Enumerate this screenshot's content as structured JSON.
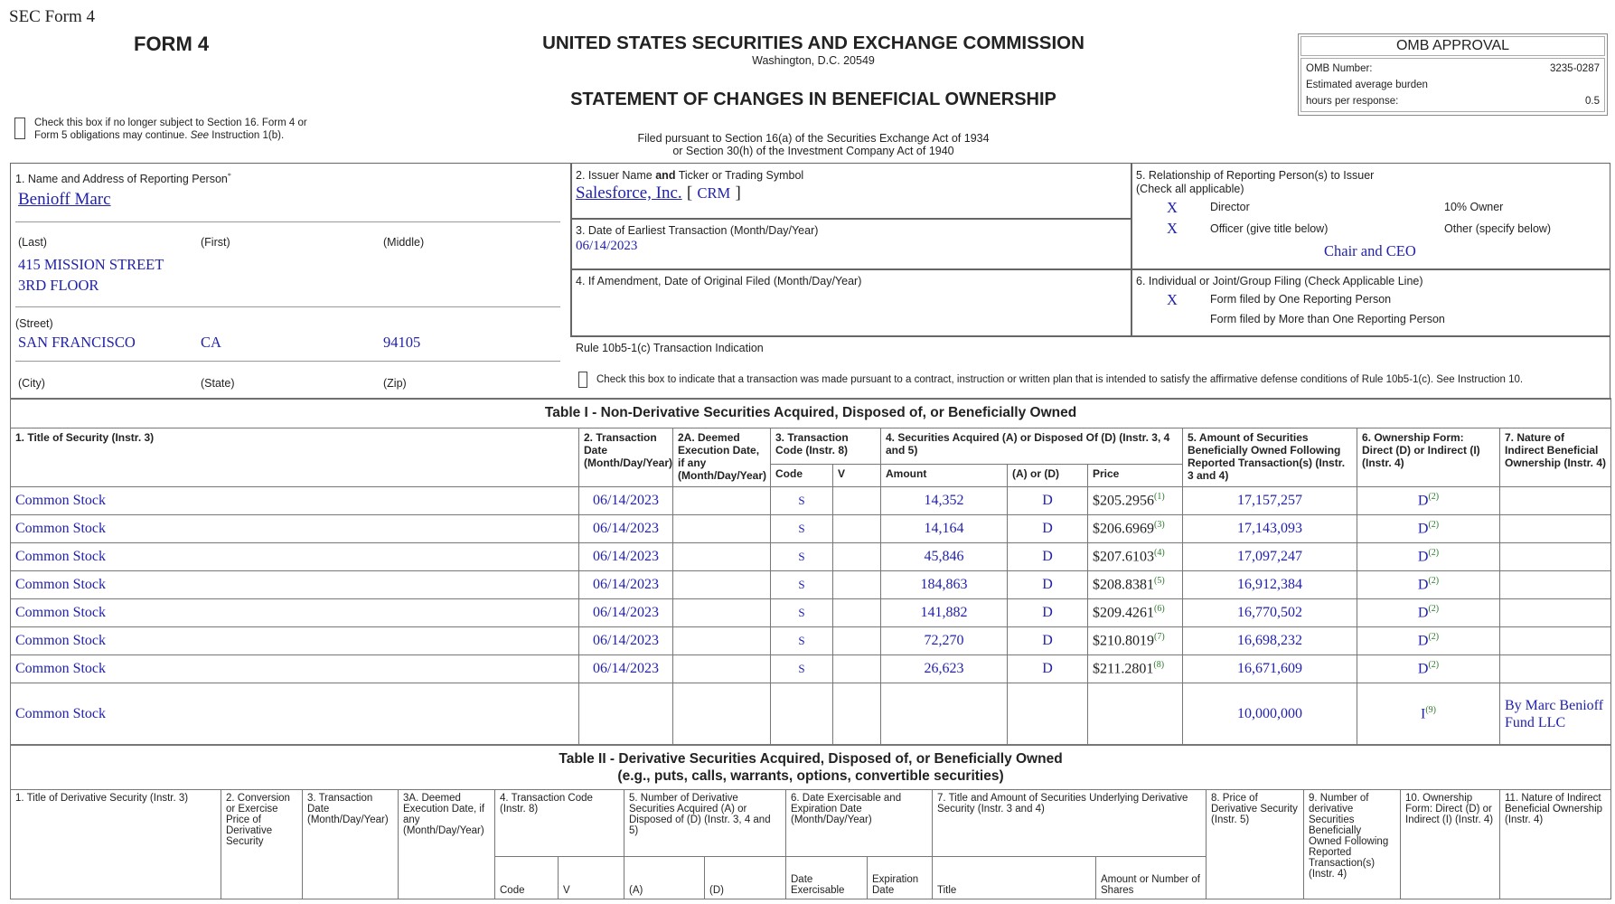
{
  "header": {
    "sec_form": "SEC Form 4",
    "form": "FORM 4",
    "agency": "UNITED STATES SECURITIES AND EXCHANGE COMMISSION",
    "location": "Washington, D.C. 20549",
    "statement": "STATEMENT OF CHANGES IN BENEFICIAL OWNERSHIP",
    "check_line1": "Check this box if no longer subject to Section 16. Form 4 or",
    "check_line2a": "Form 5 obligations may continue. ",
    "check_line2b": "See",
    "check_line2c": " Instruction 1(b).",
    "filed1": "Filed pursuant to Section 16(a) of the Securities Exchange Act of 1934",
    "filed2": "or Section 30(h) of the Investment Company Act of 1940"
  },
  "omb": {
    "title": "OMB APPROVAL",
    "number_label": "OMB Number:",
    "number": "3235-0287",
    "burden1": "Estimated average burden",
    "burden2": "hours per response:",
    "hours": "0.5"
  },
  "box1": {
    "label": "1. Name and Address of Reporting Person",
    "star": "*",
    "name": "Benioff Marc",
    "last": "(Last)",
    "first": "(First)",
    "middle": "(Middle)",
    "street1": "415 MISSION STREET",
    "street2": "3RD FLOOR",
    "street": "(Street)",
    "city": "SAN FRANCISCO",
    "state": "CA",
    "zip": "94105",
    "city_l": "(City)",
    "state_l": "(State)",
    "zip_l": "(Zip)"
  },
  "box2": {
    "label_a": "2. Issuer Name ",
    "label_b": "and",
    "label_c": " Ticker or Trading Symbol",
    "issuer": "Salesforce, Inc.",
    "ticker": "CRM",
    "lb": "[",
    "rb": "]"
  },
  "box3": {
    "label": "3. Date of Earliest Transaction (Month/Day/Year)",
    "date": "06/14/2023"
  },
  "box4": {
    "label": "4. If Amendment, Date of Original Filed (Month/Day/Year)"
  },
  "box5": {
    "label1": "5. Relationship of Reporting Person(s) to Issuer",
    "label2": "(Check all applicable)",
    "director_x": "X",
    "director": "Director",
    "owner": "10% Owner",
    "officer_x": "X",
    "officer": "Officer (give title below)",
    "other": "Other (specify below)",
    "title": "Chair and CEO"
  },
  "box6": {
    "label": "6. Individual or Joint/Group Filing (Check Applicable Line)",
    "one_x": "X",
    "one": "Form filed by One Reporting Person",
    "more": "Form filed by More than One Reporting Person"
  },
  "rule": {
    "label": "Rule 10b5-1(c) Transaction Indication",
    "text": "Check this box to indicate that a transaction was made pursuant to a contract, instruction or written plan that is intended to satisfy the affirmative defense conditions of Rule 10b5-1(c). See Instruction 10."
  },
  "table1": {
    "title": "Table I - Non-Derivative Securities Acquired, Disposed of, or Beneficially Owned",
    "h1": "1. Title of Security (Instr. 3)",
    "h2": "2. Transaction Date (Month/Day/Year)",
    "h2a": "2A. Deemed Execution Date, if any (Month/Day/Year)",
    "h3": "3. Transaction Code (Instr. 8)",
    "h4": "4. Securities Acquired (A) or Disposed Of (D) (Instr. 3, 4 and 5)",
    "h5": "5. Amount of Securities Beneficially Owned Following Reported Transaction(s) (Instr. 3 and 4)",
    "h6": "6. Ownership Form: Direct (D) or Indirect (I) (Instr. 4)",
    "h7": "7. Nature of Indirect Beneficial Ownership (Instr. 4)",
    "code": "Code",
    "v": "V",
    "amount": "Amount",
    "aord": "(A) or (D)",
    "price": "Price",
    "rows": [
      {
        "title": "Common Stock",
        "date": "06/14/2023",
        "code": "S",
        "amount": "14,352",
        "ad": "D",
        "price": "$205.2956",
        "pfn": "(1)",
        "owned": "17,157,257",
        "form": "D",
        "ffn": "(2)",
        "nature": ""
      },
      {
        "title": "Common Stock",
        "date": "06/14/2023",
        "code": "S",
        "amount": "14,164",
        "ad": "D",
        "price": "$206.6969",
        "pfn": "(3)",
        "owned": "17,143,093",
        "form": "D",
        "ffn": "(2)",
        "nature": ""
      },
      {
        "title": "Common Stock",
        "date": "06/14/2023",
        "code": "S",
        "amount": "45,846",
        "ad": "D",
        "price": "$207.6103",
        "pfn": "(4)",
        "owned": "17,097,247",
        "form": "D",
        "ffn": "(2)",
        "nature": ""
      },
      {
        "title": "Common Stock",
        "date": "06/14/2023",
        "code": "S",
        "amount": "184,863",
        "ad": "D",
        "price": "$208.8381",
        "pfn": "(5)",
        "owned": "16,912,384",
        "form": "D",
        "ffn": "(2)",
        "nature": ""
      },
      {
        "title": "Common Stock",
        "date": "06/14/2023",
        "code": "S",
        "amount": "141,882",
        "ad": "D",
        "price": "$209.4261",
        "pfn": "(6)",
        "owned": "16,770,502",
        "form": "D",
        "ffn": "(2)",
        "nature": ""
      },
      {
        "title": "Common Stock",
        "date": "06/14/2023",
        "code": "S",
        "amount": "72,270",
        "ad": "D",
        "price": "$210.8019",
        "pfn": "(7)",
        "owned": "16,698,232",
        "form": "D",
        "ffn": "(2)",
        "nature": ""
      },
      {
        "title": "Common Stock",
        "date": "06/14/2023",
        "code": "S",
        "amount": "26,623",
        "ad": "D",
        "price": "$211.2801",
        "pfn": "(8)",
        "owned": "16,671,609",
        "form": "D",
        "ffn": "(2)",
        "nature": ""
      },
      {
        "title": "Common Stock",
        "date": "",
        "code": "",
        "amount": "",
        "ad": "",
        "price": "",
        "pfn": "",
        "owned": "10,000,000",
        "form": "I",
        "ffn": "(9)",
        "nature": "By Marc Benioff Fund LLC"
      }
    ]
  },
  "table2": {
    "title1": "Table II - Derivative Securities Acquired, Disposed of, or Beneficially Owned",
    "title2": "(e.g., puts, calls, warrants, options, convertible securities)",
    "h1": "1. Title of Derivative Security (Instr. 3)",
    "h2": "2. Conversion or Exercise Price of Derivative Security",
    "h3": "3. Transaction Date (Month/Day/Year)",
    "h3a": "3A. Deemed Execution Date, if any (Month/Day/Year)",
    "h4": "4. Transaction Code (Instr. 8)",
    "h5": "5. Number of Derivative Securities Acquired (A) or Disposed of (D) (Instr. 3, 4 and 5)",
    "h6": "6. Date Exercisable and Expiration Date (Month/Day/Year)",
    "h7": "7. Title and Amount of Securities Underlying Derivative Security (Instr. 3 and 4)",
    "h8": "8. Price of Derivative Security (Instr. 5)",
    "h9": "9. Number of derivative Securities Beneficially Owned Following Reported Transaction(s) (Instr. 4)",
    "h10": "10. Ownership Form: Direct (D) or Indirect (I) (Instr. 4)",
    "h11": "11. Nature of Indirect Beneficial Ownership (Instr. 4)",
    "code": "Code",
    "v": "V",
    "a": "(A)",
    "d": "(D)",
    "exer": "Date Exercisable",
    "exp": "Expiration Date",
    "ttl": "Title",
    "amt": "Amount or Number of Shares"
  }
}
